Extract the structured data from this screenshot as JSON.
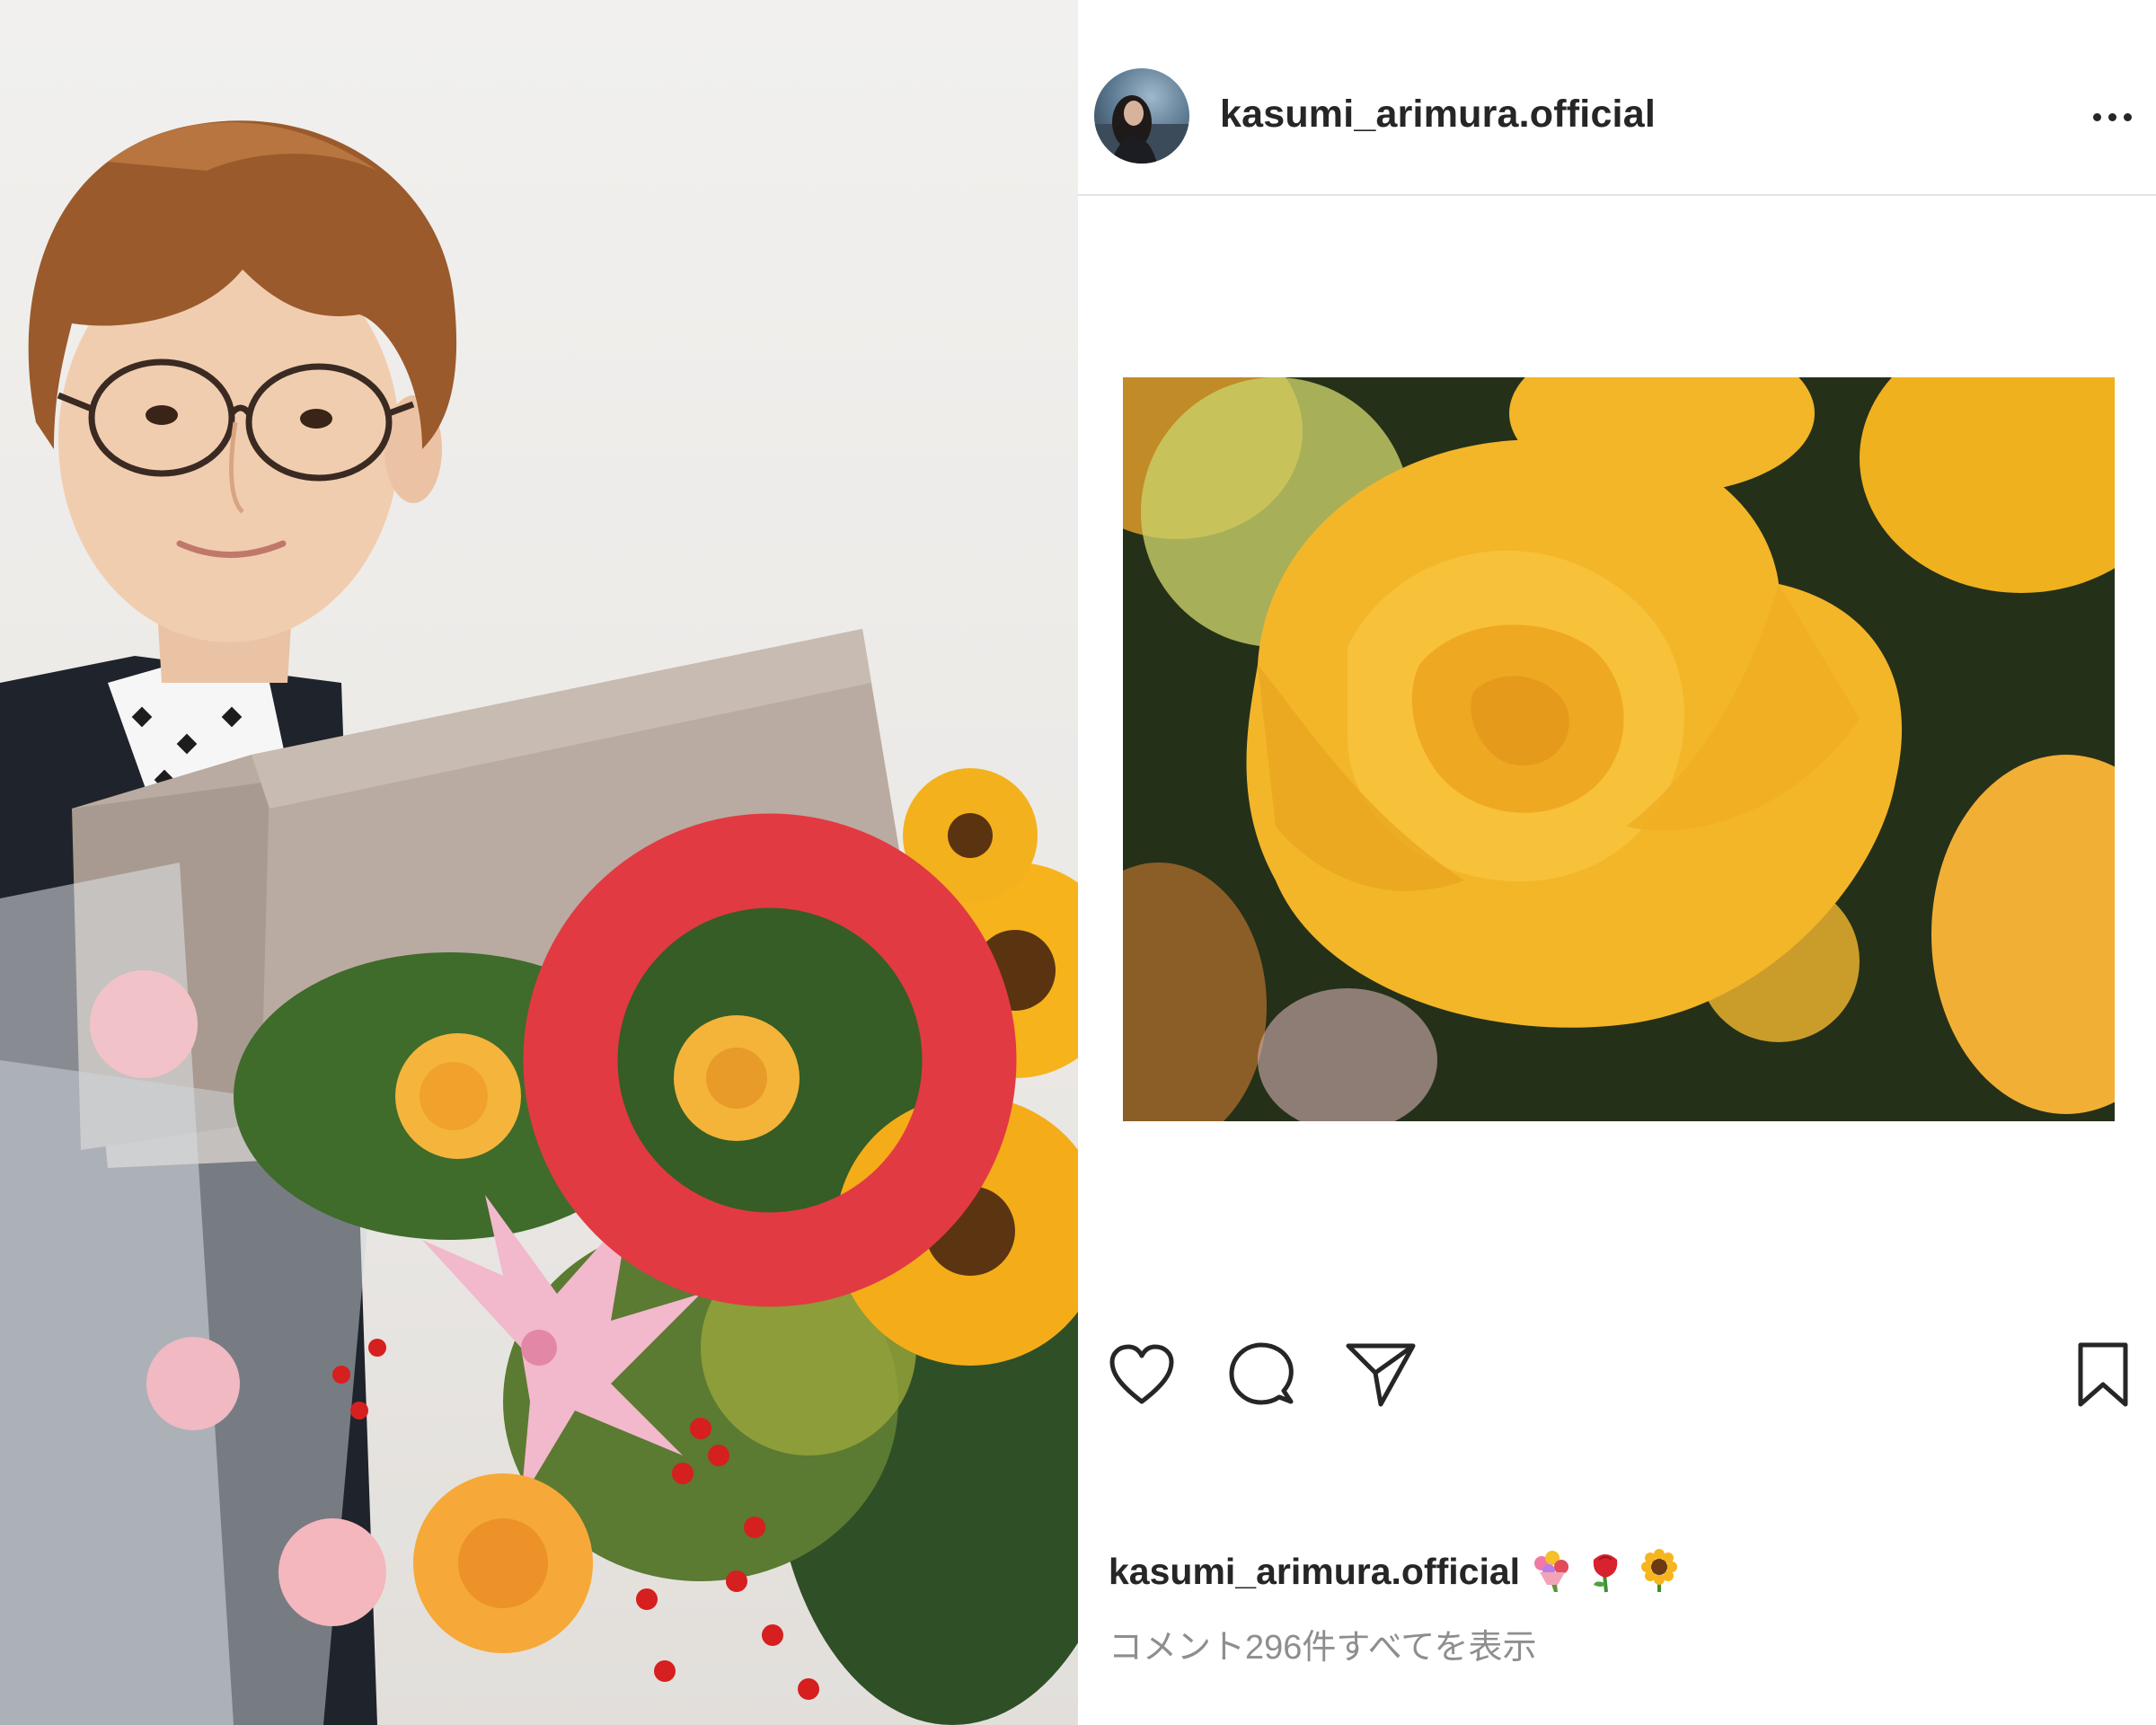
{
  "post": {
    "username": "kasumi_arimura.official",
    "more_options_icon": "more-horizontal-icon",
    "caption": {
      "username": "kasumi_arimura.official",
      "emojis": [
        "bouquet-emoji",
        "rose-emoji",
        "sunflower-emoji"
      ]
    },
    "view_comments_label": "コメント296件すべてを表示"
  },
  "actions": {
    "icons": [
      "heart-icon",
      "comment-icon",
      "share-icon",
      "bookmark-icon"
    ]
  },
  "colors": {
    "highlight_circle": "#e23a42",
    "rose_yellow": "#f5b62a",
    "text_primary": "#262626",
    "text_secondary": "#8e8e8e"
  }
}
